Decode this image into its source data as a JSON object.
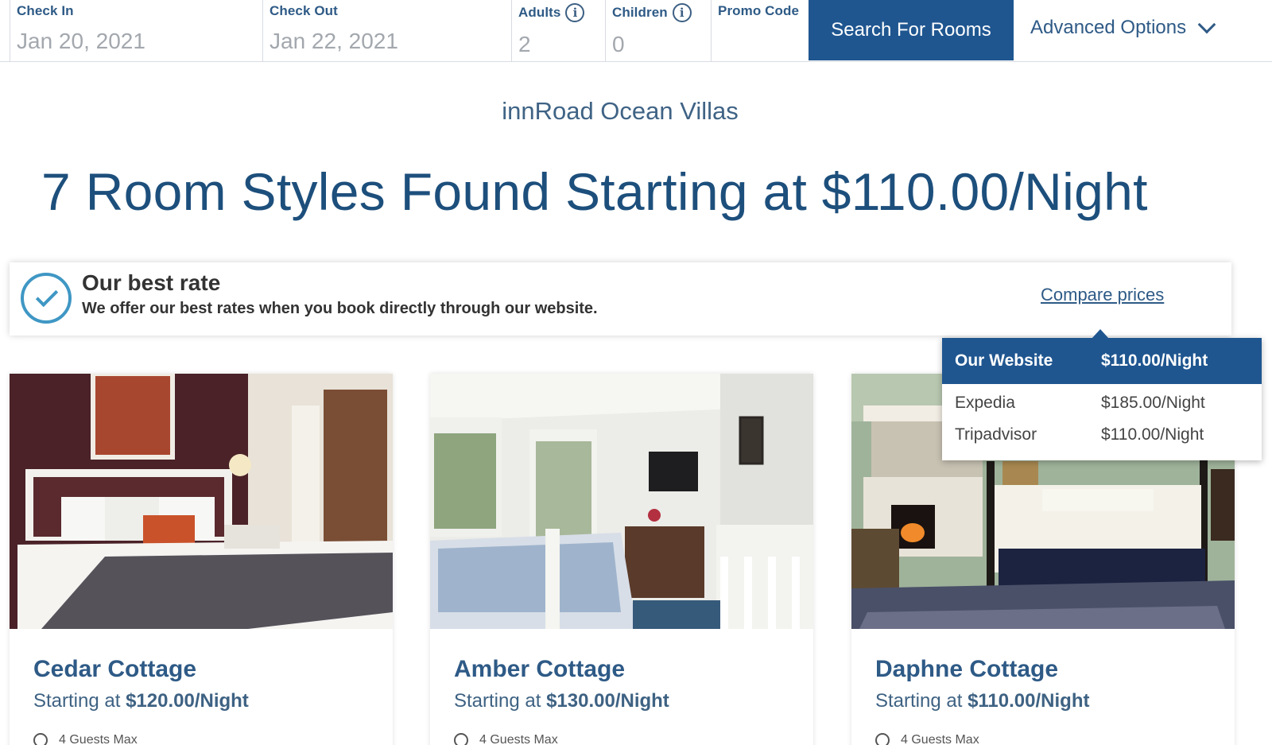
{
  "search": {
    "check_in_label": "Check In",
    "check_in_value": "Jan 20, 2021",
    "check_out_label": "Check Out",
    "check_out_value": "Jan 22, 2021",
    "adults_label": "Adults",
    "adults_value": "2",
    "children_label": "Children",
    "children_value": "0",
    "promo_label": "Promo Code",
    "promo_value": "",
    "search_button": "Search For Rooms",
    "advanced_options": "Advanced Options",
    "info_icon_glyph": "i"
  },
  "hotel_name": "innRoad Ocean Villas",
  "headline": "7 Room Styles Found Starting at $110.00/Night",
  "best_rate": {
    "title": "Our best rate",
    "subtitle": "We offer our best rates when you book directly through our website.",
    "compare_link": "Compare prices"
  },
  "compare_popup": {
    "rows": [
      {
        "site": "Our Website",
        "price": "$110.00/Night"
      },
      {
        "site": "Expedia",
        "price": "$185.00/Night"
      },
      {
        "site": "Tripadvisor",
        "price": "$110.00/Night"
      }
    ]
  },
  "rooms": [
    {
      "name": "Cedar Cottage",
      "price_prefix": "Starting at",
      "price": "$120.00/Night",
      "guests": "4 Guests Max"
    },
    {
      "name": "Amber Cottage",
      "price_prefix": "Starting at",
      "price": "$130.00/Night",
      "guests": "4 Guests Max"
    },
    {
      "name": "Daphne Cottage",
      "price_prefix": "Starting at",
      "price": "$110.00/Night",
      "guests": "4 Guests Max"
    }
  ],
  "colors": {
    "accent": "#1f5690",
    "heading": "#1d4f7c",
    "check": "#3f97c4"
  }
}
